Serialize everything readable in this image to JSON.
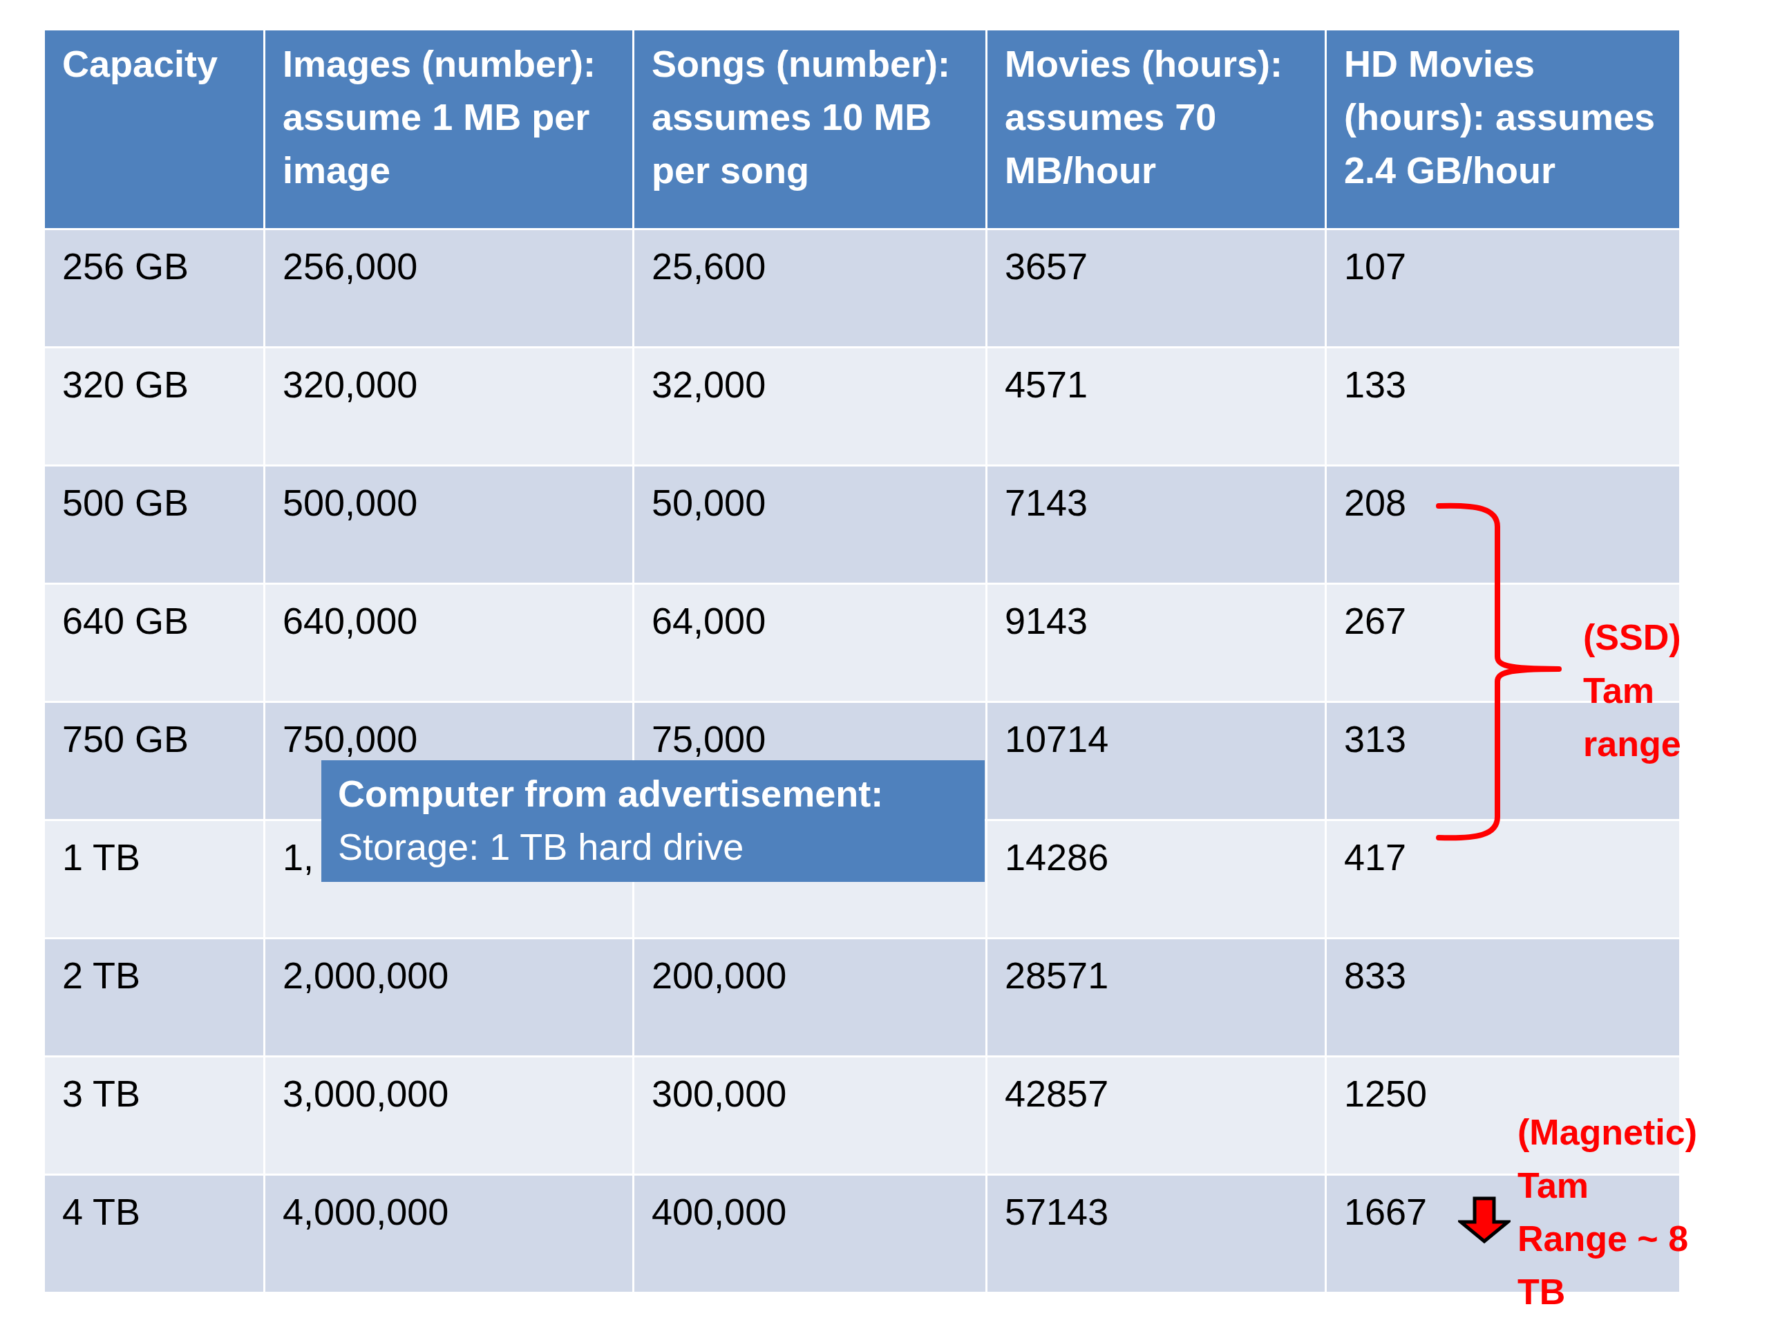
{
  "table": {
    "columns": [
      "Capacity",
      "Images (number): assume 1 MB per image",
      "Songs (number): assumes 10 MB per song",
      "Movies (hours): assumes 70 MB/hour",
      "HD Movies (hours): assumes 2.4 GB/hour"
    ],
    "rows": [
      {
        "capacity": "256 GB",
        "images": "256,000",
        "songs": "25,600",
        "movies": "3657",
        "hd_movies": "107"
      },
      {
        "capacity": "320 GB",
        "images": "320,000",
        "songs": "32,000",
        "movies": "4571",
        "hd_movies": "133"
      },
      {
        "capacity": "500 GB",
        "images": "500,000",
        "songs": "50,000",
        "movies": "7143",
        "hd_movies": "208"
      },
      {
        "capacity": "640 GB",
        "images": "640,000",
        "songs": "64,000",
        "movies": "9143",
        "hd_movies": "267"
      },
      {
        "capacity": "750 GB",
        "images": "750,000",
        "songs": "75,000",
        "movies": "10714",
        "hd_movies": "313"
      },
      {
        "capacity": "1 TB",
        "images": "1,",
        "movies": "14286",
        "hd_movies": "417"
      },
      {
        "capacity": "2 TB",
        "images": "2,000,000",
        "songs": "200,000",
        "movies": "28571",
        "hd_movies": "833"
      },
      {
        "capacity": "3 TB",
        "images": "3,000,000",
        "songs": "300,000",
        "movies": "42857",
        "hd_movies": "1250"
      },
      {
        "capacity": "4 TB",
        "images": "4,000,000",
        "songs": "400,000",
        "movies": "57143",
        "hd_movies": "1667"
      }
    ]
  },
  "callout": {
    "title": "Computer from advertisement:",
    "text": "Storage: 1 TB hard drive"
  },
  "annotations": [
    {
      "kind": "brace",
      "text": "(SSD) Tam range"
    },
    {
      "kind": "arrow",
      "text": "(Magnetic) Tam Range ~ 8 TB"
    }
  ]
}
